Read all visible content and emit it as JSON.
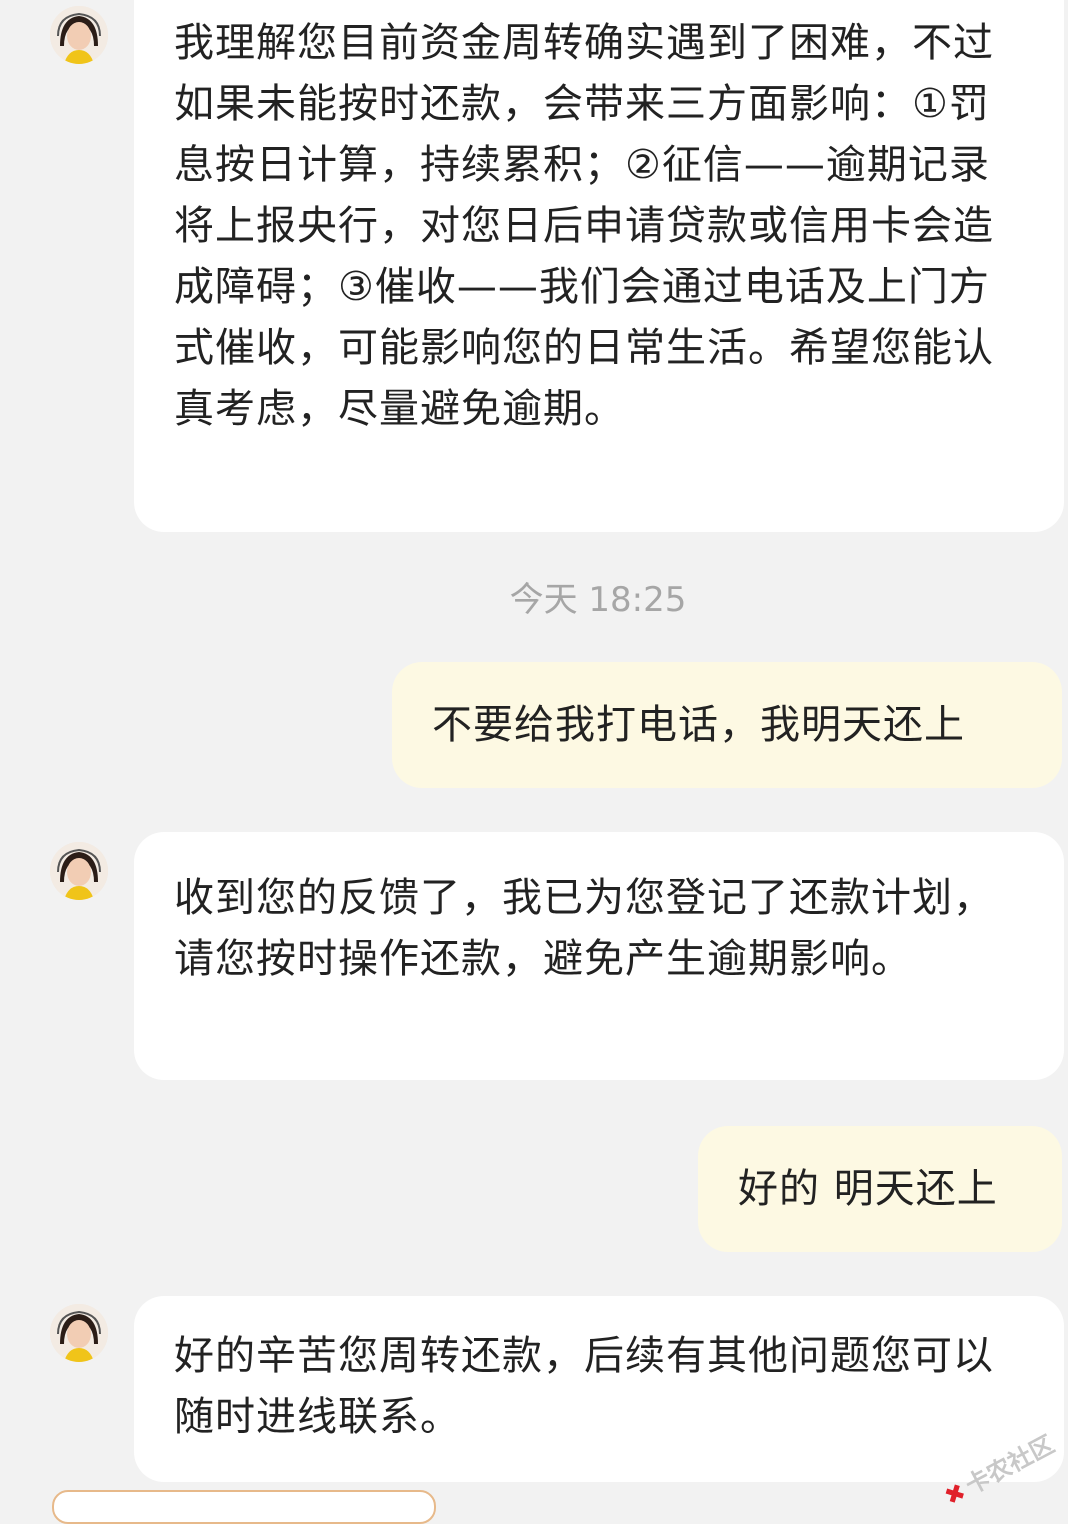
{
  "conversation": {
    "messages": [
      {
        "sender": "agent",
        "text": "我理解您目前资金周转确实遇到了困难，不过如果未能按时还款，会带来三方面影响：①罚息按日计算，持续累积；②征信——逾期记录将上报央行，对您日后申请贷款或信用卡会造成障碍；③催收——我们会通过电话及上门方式催收，可能影响您的日常生活。希望您能认真考虑，尽量避免逾期。"
      },
      {
        "sender": "timestamp",
        "text": "今天 18:25"
      },
      {
        "sender": "user",
        "text": "不要给我打电话，我明天还上"
      },
      {
        "sender": "agent",
        "text": "收到您的反馈了，我已为您登记了还款计划，请您按时操作还款，避免产生逾期影响。"
      },
      {
        "sender": "user",
        "text": "好的 明天还上"
      },
      {
        "sender": "agent",
        "text": "好的辛苦您周转还款，后续有其他问题您可以随时进线联系。"
      }
    ]
  },
  "watermark": {
    "text": "卡农社区"
  },
  "colors": {
    "background": "#f2f2f2",
    "agent_bubble": "#ffffff",
    "user_bubble": "#fdf9e3",
    "timestamp_text": "#a6a6a6"
  }
}
